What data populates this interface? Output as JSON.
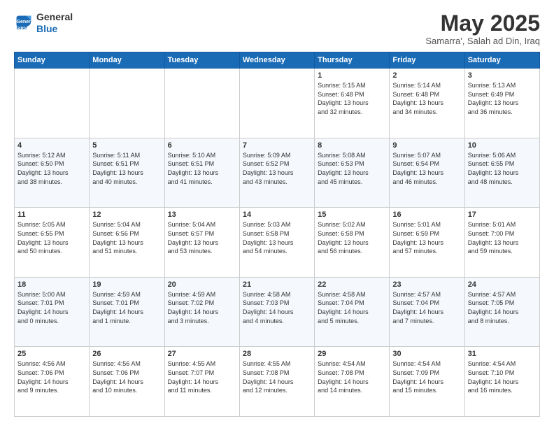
{
  "header": {
    "logo_line1": "General",
    "logo_line2": "Blue",
    "month_title": "May 2025",
    "subtitle": "Samarra', Salah ad Din, Iraq"
  },
  "weekdays": [
    "Sunday",
    "Monday",
    "Tuesday",
    "Wednesday",
    "Thursday",
    "Friday",
    "Saturday"
  ],
  "weeks": [
    [
      {
        "day": "",
        "text": ""
      },
      {
        "day": "",
        "text": ""
      },
      {
        "day": "",
        "text": ""
      },
      {
        "day": "",
        "text": ""
      },
      {
        "day": "1",
        "text": "Sunrise: 5:15 AM\nSunset: 6:48 PM\nDaylight: 13 hours\nand 32 minutes."
      },
      {
        "day": "2",
        "text": "Sunrise: 5:14 AM\nSunset: 6:48 PM\nDaylight: 13 hours\nand 34 minutes."
      },
      {
        "day": "3",
        "text": "Sunrise: 5:13 AM\nSunset: 6:49 PM\nDaylight: 13 hours\nand 36 minutes."
      }
    ],
    [
      {
        "day": "4",
        "text": "Sunrise: 5:12 AM\nSunset: 6:50 PM\nDaylight: 13 hours\nand 38 minutes."
      },
      {
        "day": "5",
        "text": "Sunrise: 5:11 AM\nSunset: 6:51 PM\nDaylight: 13 hours\nand 40 minutes."
      },
      {
        "day": "6",
        "text": "Sunrise: 5:10 AM\nSunset: 6:51 PM\nDaylight: 13 hours\nand 41 minutes."
      },
      {
        "day": "7",
        "text": "Sunrise: 5:09 AM\nSunset: 6:52 PM\nDaylight: 13 hours\nand 43 minutes."
      },
      {
        "day": "8",
        "text": "Sunrise: 5:08 AM\nSunset: 6:53 PM\nDaylight: 13 hours\nand 45 minutes."
      },
      {
        "day": "9",
        "text": "Sunrise: 5:07 AM\nSunset: 6:54 PM\nDaylight: 13 hours\nand 46 minutes."
      },
      {
        "day": "10",
        "text": "Sunrise: 5:06 AM\nSunset: 6:55 PM\nDaylight: 13 hours\nand 48 minutes."
      }
    ],
    [
      {
        "day": "11",
        "text": "Sunrise: 5:05 AM\nSunset: 6:55 PM\nDaylight: 13 hours\nand 50 minutes."
      },
      {
        "day": "12",
        "text": "Sunrise: 5:04 AM\nSunset: 6:56 PM\nDaylight: 13 hours\nand 51 minutes."
      },
      {
        "day": "13",
        "text": "Sunrise: 5:04 AM\nSunset: 6:57 PM\nDaylight: 13 hours\nand 53 minutes."
      },
      {
        "day": "14",
        "text": "Sunrise: 5:03 AM\nSunset: 6:58 PM\nDaylight: 13 hours\nand 54 minutes."
      },
      {
        "day": "15",
        "text": "Sunrise: 5:02 AM\nSunset: 6:58 PM\nDaylight: 13 hours\nand 56 minutes."
      },
      {
        "day": "16",
        "text": "Sunrise: 5:01 AM\nSunset: 6:59 PM\nDaylight: 13 hours\nand 57 minutes."
      },
      {
        "day": "17",
        "text": "Sunrise: 5:01 AM\nSunset: 7:00 PM\nDaylight: 13 hours\nand 59 minutes."
      }
    ],
    [
      {
        "day": "18",
        "text": "Sunrise: 5:00 AM\nSunset: 7:01 PM\nDaylight: 14 hours\nand 0 minutes."
      },
      {
        "day": "19",
        "text": "Sunrise: 4:59 AM\nSunset: 7:01 PM\nDaylight: 14 hours\nand 1 minute."
      },
      {
        "day": "20",
        "text": "Sunrise: 4:59 AM\nSunset: 7:02 PM\nDaylight: 14 hours\nand 3 minutes."
      },
      {
        "day": "21",
        "text": "Sunrise: 4:58 AM\nSunset: 7:03 PM\nDaylight: 14 hours\nand 4 minutes."
      },
      {
        "day": "22",
        "text": "Sunrise: 4:58 AM\nSunset: 7:04 PM\nDaylight: 14 hours\nand 5 minutes."
      },
      {
        "day": "23",
        "text": "Sunrise: 4:57 AM\nSunset: 7:04 PM\nDaylight: 14 hours\nand 7 minutes."
      },
      {
        "day": "24",
        "text": "Sunrise: 4:57 AM\nSunset: 7:05 PM\nDaylight: 14 hours\nand 8 minutes."
      }
    ],
    [
      {
        "day": "25",
        "text": "Sunrise: 4:56 AM\nSunset: 7:06 PM\nDaylight: 14 hours\nand 9 minutes."
      },
      {
        "day": "26",
        "text": "Sunrise: 4:56 AM\nSunset: 7:06 PM\nDaylight: 14 hours\nand 10 minutes."
      },
      {
        "day": "27",
        "text": "Sunrise: 4:55 AM\nSunset: 7:07 PM\nDaylight: 14 hours\nand 11 minutes."
      },
      {
        "day": "28",
        "text": "Sunrise: 4:55 AM\nSunset: 7:08 PM\nDaylight: 14 hours\nand 12 minutes."
      },
      {
        "day": "29",
        "text": "Sunrise: 4:54 AM\nSunset: 7:08 PM\nDaylight: 14 hours\nand 14 minutes."
      },
      {
        "day": "30",
        "text": "Sunrise: 4:54 AM\nSunset: 7:09 PM\nDaylight: 14 hours\nand 15 minutes."
      },
      {
        "day": "31",
        "text": "Sunrise: 4:54 AM\nSunset: 7:10 PM\nDaylight: 14 hours\nand 16 minutes."
      }
    ]
  ]
}
